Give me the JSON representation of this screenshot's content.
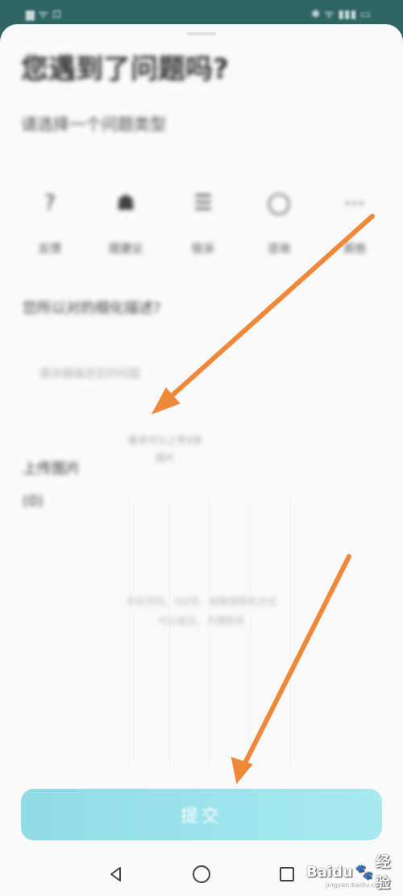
{
  "status_bar": {
    "left_text": "▆ ᯤ ⊡",
    "right_text": "✱ ᯤ ▮▮▮ ▭"
  },
  "page": {
    "title": "您遇到了问题吗?",
    "subtitle": "请选择一个问题类型"
  },
  "categories": [
    {
      "icon": "question-icon",
      "glyph": "?",
      "label": "反馈"
    },
    {
      "icon": "briefcase-icon",
      "glyph": "☗",
      "label": "提建议"
    },
    {
      "icon": "chat-icon",
      "glyph": "☰",
      "label": "投诉"
    },
    {
      "icon": "circle-icon",
      "glyph": "◯",
      "label": "咨询"
    },
    {
      "icon": "more-icon",
      "glyph": "⋯",
      "label": "其他"
    }
  ],
  "description": {
    "question": "您所以对的细化描述?",
    "placeholder": "请详细描述您的问题"
  },
  "upload": {
    "label": "上传图片(0)",
    "hint_line1": "最多可以上传4张",
    "hint_line2": "图片",
    "tip_line1": "手机号码、QQ号、邮箱等联系方式",
    "tip_line2": "可以留言、方便联系"
  },
  "submit": {
    "label": "提交"
  },
  "navigation": {
    "back": "back-icon",
    "home": "home-icon",
    "recents": "recents-icon"
  },
  "watermark": {
    "brand": "Baidu",
    "product": "经验",
    "sub": "jingyan.baidu.com"
  },
  "colors": {
    "accent_arrow": "#f0883a",
    "submit_start": "#8fdbe6",
    "submit_end": "#a7eaf0",
    "status_bar": "#2f6565"
  }
}
